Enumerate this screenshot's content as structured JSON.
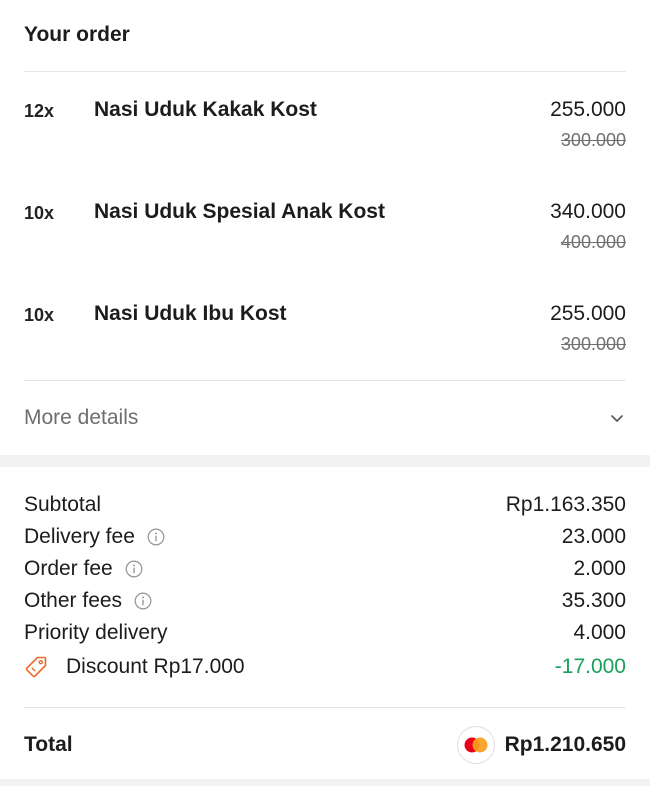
{
  "order": {
    "title": "Your order",
    "items": [
      {
        "qty": "12x",
        "name": "Nasi Uduk Kakak Kost",
        "price": "255.000",
        "original_price": "300.000"
      },
      {
        "qty": "10x",
        "name": "Nasi Uduk Spesial Anak Kost",
        "price": "340.000",
        "original_price": "400.000"
      },
      {
        "qty": "10x",
        "name": "Nasi Uduk Ibu Kost",
        "price": "255.000",
        "original_price": "300.000"
      }
    ],
    "more_details_label": "More details"
  },
  "fees": {
    "subtotal": {
      "label": "Subtotal",
      "value": "Rp1.163.350"
    },
    "delivery_fee": {
      "label": "Delivery fee",
      "value": "23.000"
    },
    "order_fee": {
      "label": "Order fee",
      "value": "2.000"
    },
    "other_fees": {
      "label": "Other fees",
      "value": "35.300"
    },
    "priority_delivery": {
      "label": "Priority delivery",
      "value": "4.000"
    },
    "discount": {
      "label": "Discount Rp17.000",
      "value": "-17.000"
    }
  },
  "total": {
    "label": "Total",
    "value": "Rp1.210.650",
    "payment_icon": "mastercard-icon"
  },
  "colors": {
    "discount": "#1aa05a",
    "tag_icon": "#ee6a2c",
    "mc_red": "#eb001b",
    "mc_orange": "#f79e1b"
  }
}
